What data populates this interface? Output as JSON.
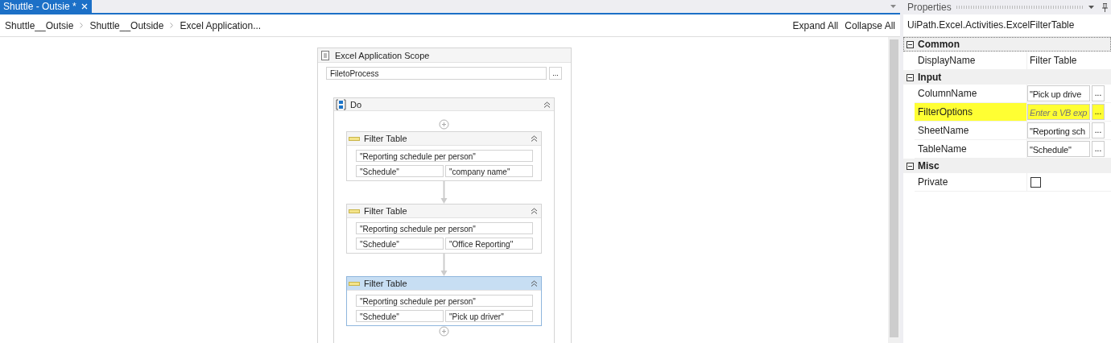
{
  "tab": {
    "title": "Shuttle - Outsie *",
    "selected": true
  },
  "breadcrumb": [
    "Shuttle__Outsie",
    "Shuttle__Outside",
    "Excel Application..."
  ],
  "actions": [
    "Expand All",
    "Collapse All"
  ],
  "scope": {
    "title": "Excel Application Scope",
    "file": "FiletoProcess",
    "browse": "...",
    "sequence": {
      "title": "Do",
      "expanded": true,
      "activities": [
        {
          "title": "Filter Table",
          "sheet": "\"Reporting schedule per person\"",
          "table": "\"Schedule\"",
          "column": "\"company name\"",
          "selected": false
        },
        {
          "title": "Filter Table",
          "sheet": "\"Reporting schedule per person\"",
          "table": "\"Schedule\"",
          "column": "\"Office Reporting\"",
          "selected": false
        },
        {
          "title": "Filter Table",
          "sheet": "\"Reporting schedule per person\"",
          "table": "\"Schedule\"",
          "column": "\"Pick up driver\"",
          "selected": true
        }
      ]
    }
  },
  "properties": {
    "title": "Properties",
    "type_name": "UiPath.Excel.Activities.ExcelFilterTable",
    "categories": [
      {
        "name": "Common",
        "expanded": true,
        "properties": [
          {
            "name": "DisplayName",
            "kind": "text",
            "value": "Filter Table"
          }
        ]
      },
      {
        "name": "Input",
        "expanded": true,
        "properties": [
          {
            "name": "ColumnName",
            "kind": "expression",
            "value": "\"Pick up drive",
            "browse": "...",
            "highlighted": false
          },
          {
            "name": "FilterOptions",
            "kind": "expression",
            "placeholder": "Enter a VB exp",
            "browse": "...",
            "highlighted": true
          },
          {
            "name": "SheetName",
            "kind": "expression",
            "value": "\"Reporting sch",
            "browse": "...",
            "highlighted": false
          },
          {
            "name": "TableName",
            "kind": "expression",
            "value": "\"Schedule\"",
            "browse": "...",
            "highlighted": false
          }
        ]
      },
      {
        "name": "Misc",
        "expanded": true,
        "properties": [
          {
            "name": "Private",
            "kind": "checkbox",
            "checked": false
          }
        ]
      }
    ]
  }
}
